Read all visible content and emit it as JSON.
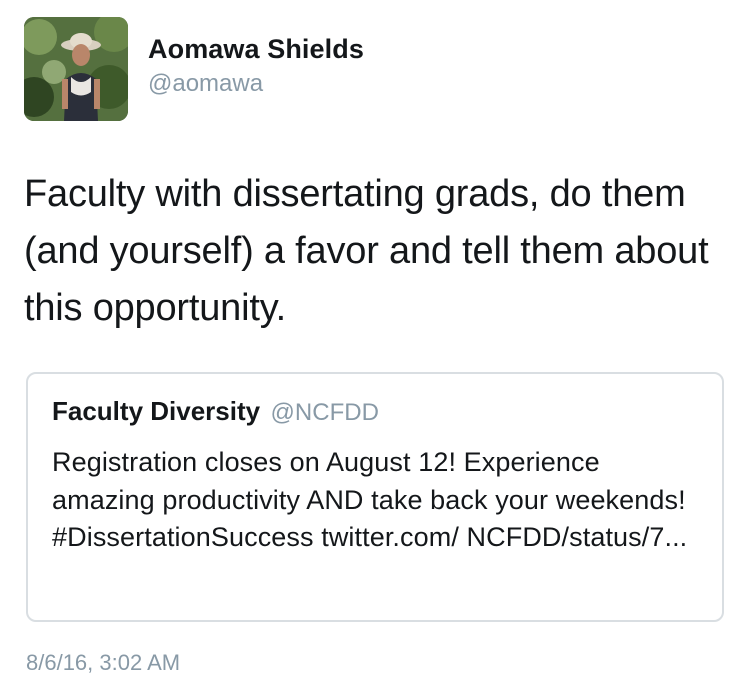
{
  "author": {
    "display_name": "Aomawa Shields",
    "handle": "@aomawa"
  },
  "tweet": {
    "text": "Faculty with dissertating grads, do them (and yourself) a favor and tell them about this opportunity.",
    "timestamp": "8/6/16, 3:02 AM"
  },
  "quoted_tweet": {
    "display_name": "Faculty Diversity",
    "handle": "@NCFDD",
    "text": "Registration closes on August 12! Experience amazing productivity AND take back your weekends! #DissertationSuccess twitter.com/ NCFDD/status/7..."
  },
  "colors": {
    "text": "#14171a",
    "secondary": "#8899a6",
    "border": "#d9dee2"
  }
}
